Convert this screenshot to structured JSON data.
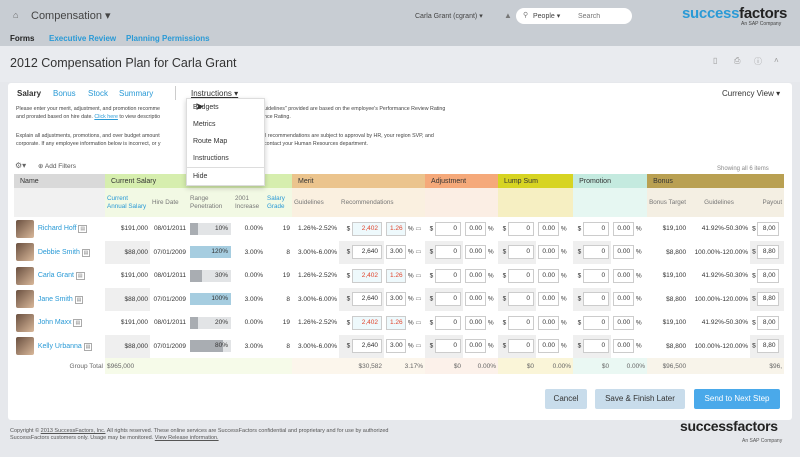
{
  "header": {
    "module": "Compensation",
    "user": "Carla Grant (cgrant)",
    "search_scope": "People",
    "search_placeholder": "Search",
    "logo_main": "success",
    "logo_bold": "factors",
    "logo_sub": "An SAP Company"
  },
  "nav": [
    {
      "label": "Forms",
      "active": true
    },
    {
      "label": "Executive Review"
    },
    {
      "label": "Planning Permissions"
    }
  ],
  "page_title": "2012 Compensation Plan for Carla Grant",
  "tabs": [
    {
      "label": "Salary",
      "active": true
    },
    {
      "label": "Bonus"
    },
    {
      "label": "Stock"
    },
    {
      "label": "Summary"
    }
  ],
  "instructions_label": "Instructions",
  "currency_view": "Currency View",
  "instructions_text": {
    "p1a": "Please enter your merit, adjustment, and promotion recomme",
    "p1b": "uidelines\" provided are based on the employee's Performance Review Rating",
    "p2a": "and prorated based on hire date.",
    "link": "Click here",
    "p2b": "to view descriptio",
    "p2c": "nce Rating.",
    "p3a": "Explain all adjustments, promotions, and over budget amount",
    "p3b": "ll recommendations are subject to approval by HR, your region SVP, and",
    "p4a": "corporate. If any employee information below is incorrect, or y",
    "p4b": "contact your Human Resources department."
  },
  "dropdown": [
    "Budgets",
    "Metrics",
    "Route Map",
    "Instructions",
    "Hide"
  ],
  "add_filters": "Add Filters",
  "showing": "Showing  all 6 items",
  "bands": [
    {
      "label": "Name",
      "color": "#d9d9d9",
      "sub": "#f1f1f1"
    },
    {
      "label": "Current Salary",
      "color": "#d6eeae",
      "sub": "#f2f9e4"
    },
    {
      "label": "Merit",
      "color": "#ebc48d",
      "sub": "#faf0e0"
    },
    {
      "label": "Adjustment",
      "color": "#f5a97a",
      "sub": "#fbeee4"
    },
    {
      "label": "Lump Sum",
      "color": "#d7d422",
      "sub": "#f6efc2"
    },
    {
      "label": "Promotion",
      "color": "#c4eadf",
      "sub": "#e6f7f2"
    },
    {
      "label": "Bonus",
      "color": "#b9a052",
      "sub": "#f4efe3"
    }
  ],
  "columns": {
    "annual_salary": "Current Annual Salary",
    "hire_date": "Hire Date",
    "range": "Range Penetration",
    "increase": "2001 Increase",
    "grade": "Salary Grade",
    "guidelines": "Guidelines",
    "recommendations": "Recommendations",
    "bonus_target": "Bonus Target",
    "bonus_guidelines": "Guidelines",
    "payout": "Payout"
  },
  "rows": [
    {
      "name": "Richard Hoff",
      "salary": "$191,000",
      "hire": "08/01/2011",
      "range": 10,
      "range_label": "10%",
      "increase": "0.00%",
      "grade": "19",
      "guide": "1.26%-2.52%",
      "merit": "2,402",
      "merit_pct": "1.26",
      "highlight": true,
      "adj": "0",
      "adj_pct": "0.00",
      "lump": "0",
      "lump_pct": "0.00",
      "promo": "0",
      "promo_pct": "0.00",
      "bonus_target": "$19,100",
      "bonus_guide": "41.92%-50.30%",
      "payout": "8,00"
    },
    {
      "name": "Debbie Smith",
      "salary": "$88,000",
      "hire": "07/01/2009",
      "range": 120,
      "range_label": "120%",
      "increase": "3.00%",
      "grade": "8",
      "guide": "3.00%-6.00%",
      "merit": "2,640",
      "merit_pct": "3.00",
      "highlight": false,
      "adj": "0",
      "adj_pct": "0.00",
      "lump": "0",
      "lump_pct": "0.00",
      "promo": "0",
      "promo_pct": "0.00",
      "bonus_target": "$8,800",
      "bonus_guide": "100.00%-120.00%",
      "payout": "8,80"
    },
    {
      "name": "Carla Grant",
      "salary": "$191,000",
      "hire": "08/01/2011",
      "range": 30,
      "range_label": "30%",
      "increase": "0.00%",
      "grade": "19",
      "guide": "1.26%-2.52%",
      "merit": "2,402",
      "merit_pct": "1.26",
      "highlight": true,
      "adj": "0",
      "adj_pct": "0.00",
      "lump": "0",
      "lump_pct": "0.00",
      "promo": "0",
      "promo_pct": "0.00",
      "bonus_target": "$19,100",
      "bonus_guide": "41.92%-50.30%",
      "payout": "8,00"
    },
    {
      "name": "Jane Smith",
      "salary": "$88,000",
      "hire": "07/01/2009",
      "range": 100,
      "range_label": "100%",
      "increase": "3.00%",
      "grade": "8",
      "guide": "3.00%-6.00%",
      "merit": "2,640",
      "merit_pct": "3.00",
      "highlight": false,
      "adj": "0",
      "adj_pct": "0.00",
      "lump": "0",
      "lump_pct": "0.00",
      "promo": "0",
      "promo_pct": "0.00",
      "bonus_target": "$8,800",
      "bonus_guide": "100.00%-120.00%",
      "payout": "8,80"
    },
    {
      "name": "John Maxx",
      "salary": "$191,000",
      "hire": "08/01/2011",
      "range": 20,
      "range_label": "20%",
      "increase": "0.00%",
      "grade": "19",
      "guide": "1.26%-2.52%",
      "merit": "2,402",
      "merit_pct": "1.26",
      "highlight": true,
      "adj": "0",
      "adj_pct": "0.00",
      "lump": "0",
      "lump_pct": "0.00",
      "promo": "0",
      "promo_pct": "0.00",
      "bonus_target": "$19,100",
      "bonus_guide": "41.92%-50.30%",
      "payout": "8,00"
    },
    {
      "name": "Kelly Urbanna",
      "salary": "$88,000",
      "hire": "07/01/2009",
      "range": 80,
      "range_label": "80%",
      "increase": "3.00%",
      "grade": "8",
      "guide": "3.00%-6.00%",
      "merit": "2,640",
      "merit_pct": "3.00",
      "highlight": false,
      "adj": "0",
      "adj_pct": "0.00",
      "lump": "0",
      "lump_pct": "0.00",
      "promo": "0",
      "promo_pct": "0.00",
      "bonus_target": "$8,800",
      "bonus_guide": "100.00%-120.00%",
      "payout": "8,80"
    }
  ],
  "total": {
    "label": "Group Total",
    "salary": "$965,000",
    "merit": "$30,582",
    "merit_pct": "3.17%",
    "adj": "$0",
    "adj_pct": "0.00%",
    "lump": "$0",
    "lump_pct": "0.00%",
    "promo": "$0",
    "promo_pct": "0.00%",
    "bonus_target": "$96,500",
    "payout": "$96,"
  },
  "buttons": {
    "cancel": "Cancel",
    "save": "Save & Finish Later",
    "send": "Send to Next Step"
  },
  "footer": {
    "l1a": "Copyright ©",
    "link1": "2013 SuccessFactors, Inc.",
    "l1b": "All rights reserved. These online services are SuccessFactors confidential and proprietary and for use by authorized",
    "l2a": "SuccessFactors customers only. Usage may be monitored.",
    "link2": "View Release information."
  },
  "colors": {
    "accent": "#2a9ad6",
    "primary_button": "#4aa9ea",
    "secondary_button": "#c8dceb",
    "red_value": "#e0442c"
  }
}
